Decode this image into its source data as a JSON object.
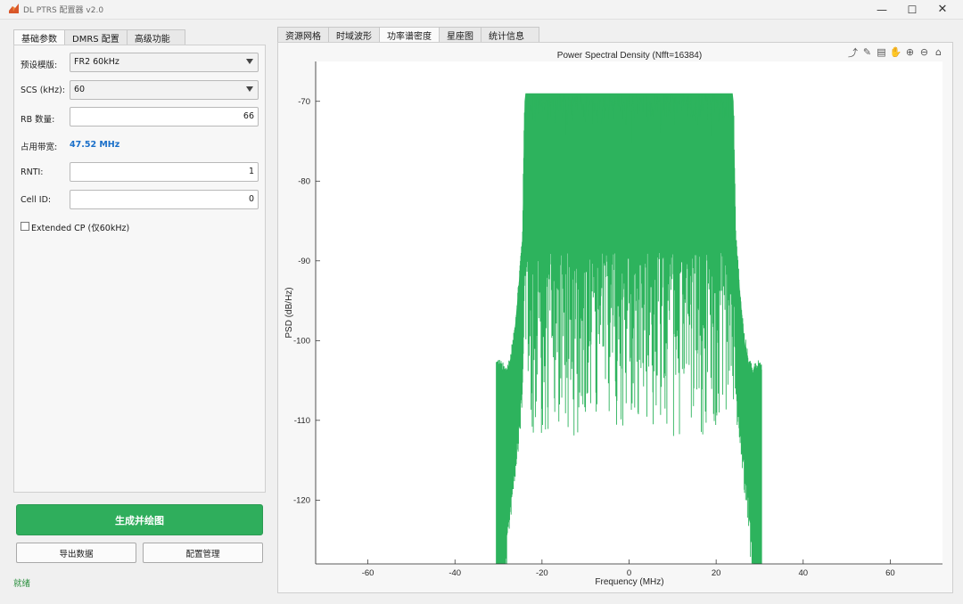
{
  "window": {
    "title": "DL PTRS 配置器 v2.0",
    "minimize_glyph": "—",
    "maximize_glyph": "☐",
    "close_glyph": "✕"
  },
  "left_tabs": [
    {
      "label": "基础参数",
      "active": true
    },
    {
      "label": "DMRS 配置",
      "active": false
    },
    {
      "label": "高级功能",
      "active": false
    }
  ],
  "form": {
    "preset_label": "预设模版:",
    "preset_value": "FR2 60kHz",
    "scs_label": "SCS (kHz):",
    "scs_value": "60",
    "rb_label": "RB 数量:",
    "rb_value": "66",
    "bw_label": "占用带宽:",
    "bw_value": "47.52 MHz",
    "rnti_label": "RNTI:",
    "rnti_value": "1",
    "cellid_label": "Cell ID:",
    "cellid_value": "0",
    "ext_cp_label": "Extended CP (仅60kHz)",
    "ext_cp_checked": false
  },
  "buttons": {
    "generate": "生成并绘图",
    "export": "导出数据",
    "config": "配置管理"
  },
  "status": "就绪",
  "right_tabs": [
    {
      "label": "资源网格",
      "active": false
    },
    {
      "label": "时域波形",
      "active": false
    },
    {
      "label": "功率谱密度",
      "active": true
    },
    {
      "label": "星座图",
      "active": false
    },
    {
      "label": "统计信息",
      "active": false
    }
  ],
  "toolbar_icons": [
    "export-icon",
    "brush-icon",
    "datatip-icon",
    "pan-icon",
    "zoom-in-icon",
    "zoom-out-icon",
    "home-icon"
  ],
  "colors": {
    "accent": "#2fae5c",
    "trace": "#2db35d",
    "bw_text": "#1a6fc9"
  },
  "chart_data": {
    "type": "line",
    "title": "Power Spectral Density (Nfft=16384)",
    "xlabel": "Frequency (MHz)",
    "ylabel": "PSD (dB/Hz)",
    "xlim": [
      -72,
      72
    ],
    "ylim": [
      -128,
      -65
    ],
    "xticks": [
      -60,
      -40,
      -20,
      0,
      20,
      40,
      60
    ],
    "yticks": [
      -70,
      -80,
      -90,
      -100,
      -110,
      -120
    ],
    "grid": false,
    "series": [
      {
        "envelope": {
          "x": [
            -30.5,
            -30.0,
            -28.5,
            -27.5,
            -26.5,
            -25.5,
            -24.5,
            -24.0,
            -23.8,
            23.8,
            24.0,
            24.5,
            25.5,
            26.5,
            27.5,
            28.5,
            30.0,
            30.5
          ],
          "upper": [
            -103,
            -103,
            -104,
            -103,
            -100,
            -94,
            -87,
            -70,
            -69,
            -69,
            -70,
            -87,
            -94,
            -100,
            -103,
            -104,
            -103,
            -103
          ],
          "lower": [
            -128,
            -128,
            -128,
            -120,
            -115,
            -110,
            -105,
            -90,
            -112,
            -112,
            -90,
            -105,
            -110,
            -115,
            -120,
            -128,
            -128,
            -128
          ]
        },
        "inband_max": -68,
        "inband_min": -112,
        "inband_typical_top": -73,
        "inband_typical_bottom": -89
      }
    ]
  }
}
